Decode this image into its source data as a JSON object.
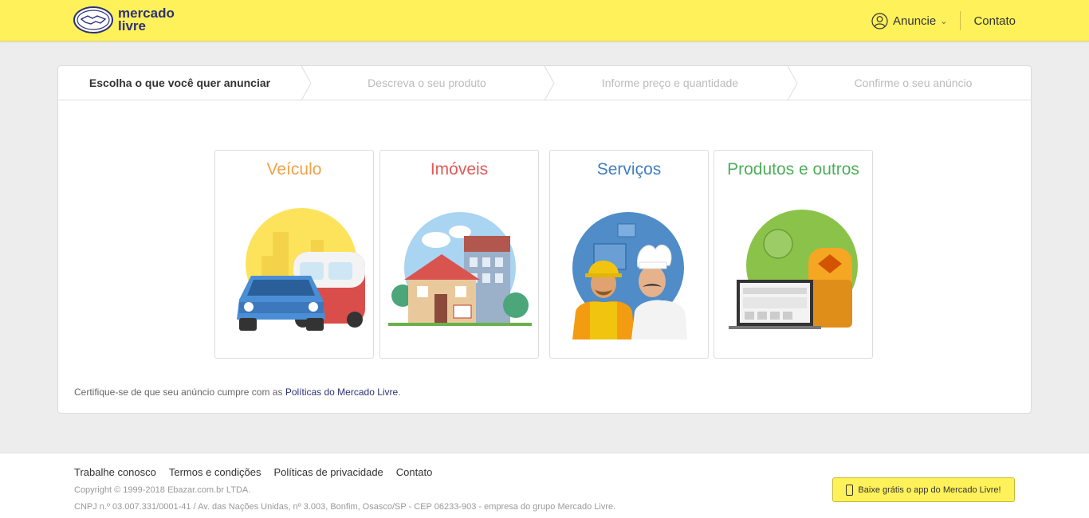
{
  "header": {
    "logo_line1": "mercado",
    "logo_line2": "livre",
    "anuncie": "Anuncie",
    "contato": "Contato"
  },
  "steps": [
    {
      "label": "Escolha o que você quer anunciar",
      "active": true
    },
    {
      "label": "Descreva o seu produto",
      "active": false
    },
    {
      "label": "Informe preço e quantidade",
      "active": false
    },
    {
      "label": "Confirme o seu anúncio",
      "active": false
    }
  ],
  "categories": [
    {
      "label": "Veículo",
      "color": "#f0a247"
    },
    {
      "label": "Imóveis",
      "color": "#e05a55"
    },
    {
      "label": "Serviços",
      "color": "#3f7fbf"
    },
    {
      "label": "Produtos e outros",
      "color": "#4fae5b"
    }
  ],
  "policy": {
    "text": "Certifique-se de que seu anúncio cumpre com as ",
    "link": "Políticas do Mercado Livre",
    "end": "."
  },
  "footer": {
    "links": [
      "Trabalhe conosco",
      "Termos e condições",
      "Políticas de privacidade",
      "Contato"
    ],
    "copyright": "Copyright © 1999-2018 Ebazar.com.br LTDA.",
    "cnpj": "CNPJ n.º 03.007.331/0001-41 / Av. das Nações Unidas, nº 3.003, Bonfim, Osasco/SP - CEP 06233-903 - empresa do grupo Mercado Livre.",
    "app_button": "Baixe grátis o app do Mercado Livre!"
  },
  "colors": {
    "brand_yellow": "#fff159",
    "brand_blue": "#2d3277"
  }
}
